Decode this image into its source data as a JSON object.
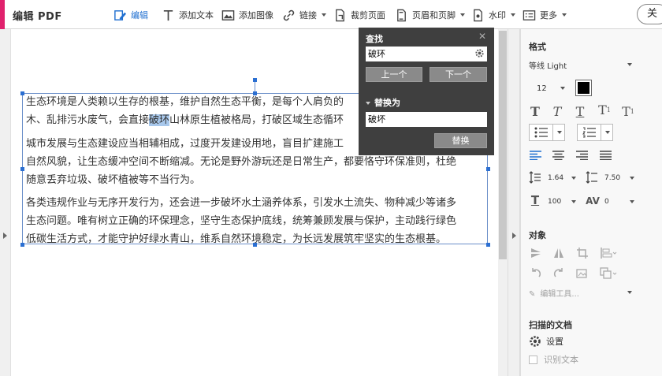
{
  "app": {
    "title": "编辑 PDF",
    "close_label": "关"
  },
  "toolbar": {
    "edit": "编辑",
    "add_text": "添加文本",
    "add_image": "添加图像",
    "link": "链接",
    "crop": "裁剪页面",
    "header_footer": "页眉和页脚",
    "watermark": "水印",
    "more": "更多"
  },
  "document": {
    "para1_line1_before": "生态环境是人类赖以生存的根基，维护自然生态平衡，是每个人肩负的",
    "para1_line2_before": "木、乱排污水废气，会直接",
    "para1_line2_highlight": "破环",
    "para1_line2_after": "山林原生植被格局，打破区域生态循环",
    "para2_line1": "城市发展与生态建设应当相辅相成，过度开发建设用地，盲目扩建施工",
    "para2_line2": "自然风貌，让生态缓冲空间不断缩减。无论是野外游玩还是日常生产，都要恪守环保准则，杜绝",
    "para2_line3": "随意丢弃垃圾、破坏植被等不当行为。",
    "para3_line1": "各类违规作业与无序开发行为，还会进一步破坏水土涵养体系，引发水土流失、物种减少等诸多",
    "para3_line2": "生态问题。唯有树立正确的环保理念，坚守生态保护底线，统筹兼顾发展与保护，主动践行绿色",
    "para3_line3": "低碳生活方式，才能守护好绿水青山，维系自然环境稳定，为长远发展筑牢坚实的生态根基。"
  },
  "find_panel": {
    "title": "查找",
    "close": "✕",
    "find_value": "破环",
    "prev": "上一个",
    "next": "下一个",
    "replace_section": "替换为",
    "replace_value": "破坏",
    "replace_button": "替换"
  },
  "format_panel": {
    "format_heading": "格式",
    "font_name": "等线 Light",
    "font_size": "12",
    "text_color": "#000000",
    "line_spacing": "1.64",
    "para_spacing": "7.50",
    "scale": "100",
    "char_spacing": "0",
    "objects_heading": "对象",
    "edit_tool_label": "编辑工具...",
    "scanned_heading": "扫描的文档",
    "settings_label": "设置",
    "recognize_label": "识别文本"
  },
  "colors": {
    "accent": "#e0216d",
    "active_tool": "#1f6fd0",
    "highlight": "#a8c8ec",
    "panel_bg": "#3f3f3f"
  }
}
